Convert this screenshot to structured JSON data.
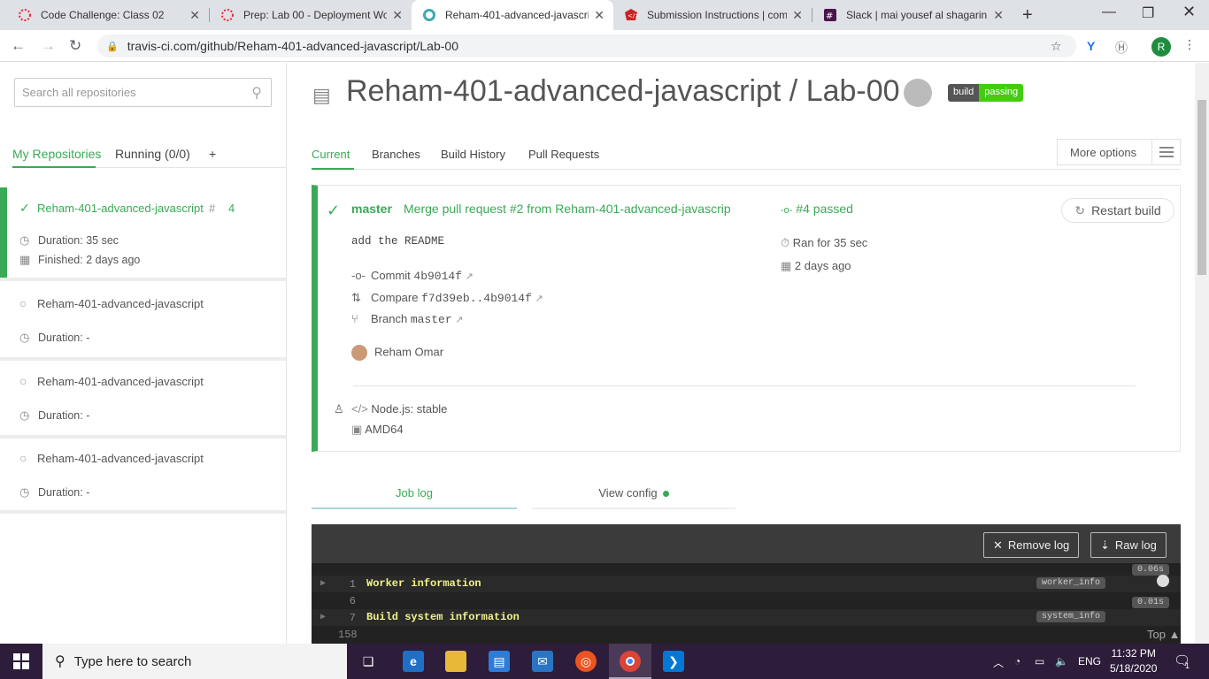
{
  "browser": {
    "tabs": [
      {
        "title": "Code Challenge: Class 02",
        "icon": "canvas-icon"
      },
      {
        "title": "Prep: Lab 00 - Deployment Wo",
        "icon": "canvas-icon"
      },
      {
        "title": "Reham-401-advanced-javascrip",
        "icon": "travis-icon",
        "active": true
      },
      {
        "title": "Submission Instructions | comm",
        "icon": "codefellows-icon"
      },
      {
        "title": "Slack | mai yousef al shagarin |",
        "icon": "slack-icon"
      }
    ],
    "new_tab": "+",
    "url": "travis-ci.com/github/Reham-401-advanced-javascript/Lab-00",
    "profile_initial": "R"
  },
  "sidebar": {
    "search_placeholder": "Search all repositories",
    "tabs": {
      "my_repos": "My Repositories",
      "running": "Running (0/0)",
      "add": "+"
    },
    "repos": [
      {
        "name": "Reham-401-advanced-javascript",
        "hash": "#",
        "number": "4",
        "duration": "Duration: 35 sec",
        "finished": "Finished: 2 days ago"
      },
      {
        "name": "Reham-401-advanced-javascript",
        "duration": "Duration: -"
      },
      {
        "name": "Reham-401-advanced-javascript",
        "duration": "Duration: -"
      },
      {
        "name": "Reham-401-advanced-javascript",
        "duration": "Duration: -"
      }
    ]
  },
  "main": {
    "title": "Reham-401-advanced-javascript / Lab-00",
    "badge": {
      "left": "build",
      "right": "passing"
    },
    "tabs": [
      "Current",
      "Branches",
      "Build History",
      "Pull Requests"
    ],
    "more_options": "More options",
    "build": {
      "branch": "master",
      "commit_message": "Merge pull request #2 from Reham-401-advanced-javascrip",
      "description": "add the README",
      "commit_label": "Commit",
      "commit_hash": "4b9014f",
      "compare_label": "Compare",
      "compare_range": "f7d39eb..4b9014f",
      "branch_label": "Branch",
      "branch_name": "master",
      "author": "Reham Omar",
      "status": "#4 passed",
      "ran_for": "Ran for 35 sec",
      "when": "2 days ago",
      "restart": "Restart build",
      "language": "Node.js: stable",
      "arch": "AMD64"
    },
    "job_tabs": {
      "log": "Job log",
      "config": "View config"
    },
    "log": {
      "remove": "Remove log",
      "raw": "Raw log",
      "rows": [
        {
          "ln": "1",
          "text": "Worker information",
          "tag": "worker_info",
          "time": "0.06s"
        },
        {
          "ln": "6",
          "text": "",
          "tag": "",
          "time": ""
        },
        {
          "ln": "7",
          "text": "Build system information",
          "tag": "system_info",
          "time": "0.01s"
        },
        {
          "ln": "158",
          "text": "",
          "tag": "",
          "time": ""
        }
      ],
      "top": "Top"
    }
  },
  "taskbar": {
    "search": "Type here to search",
    "lang": "ENG",
    "time": "11:32 PM",
    "date": "5/18/2020",
    "notifications": "1"
  }
}
